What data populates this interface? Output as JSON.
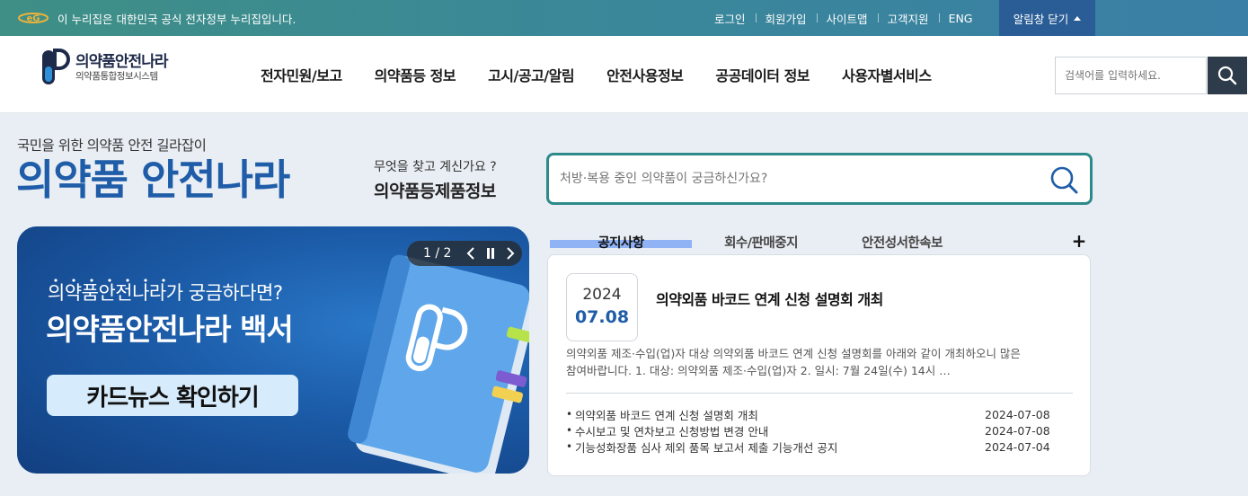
{
  "gov_banner": {
    "text": "이 누리집은 대한민국 공식 전자정부 누리집입니다.",
    "links": [
      "로그인",
      "회원가입",
      "사이트맵",
      "고객지원",
      "ENG"
    ],
    "close_label": "알림창 닫기"
  },
  "header": {
    "logo_title": "의약품안전나라",
    "logo_subtitle": "의약품통합정보시스템",
    "nav": [
      "전자민원/보고",
      "의약품등 정보",
      "고시/공고/알림",
      "안전사용정보",
      "공공데이터 정보",
      "사용자별서비스"
    ],
    "search_placeholder": "검색어를 입력하세요."
  },
  "hero": {
    "subtitle": "국민을 위한 의약품 안전 길라잡이",
    "title": "의약품 안전나라",
    "question": "무엇을 찾고 계신가요 ?",
    "category": "의약품등제품정보",
    "search_placeholder": "처방·복용 중인 의약품이 궁금하신가요?"
  },
  "banner": {
    "subtitle": "의약품안전나라가 궁금하다면?",
    "title": "의약품안전나라 백서",
    "cta": "카드뉴스 확인하기",
    "pager": "1 / 2"
  },
  "notice": {
    "tabs": [
      "공지사항",
      "회수/판매중지",
      "안전성서한속보"
    ],
    "more": "+",
    "featured": {
      "year": "2024",
      "date": "07.08",
      "title": "의약외품 바코드 연계 신청 설명회 개최",
      "body": "의약외품 제조·수입(업)자 대상 의약외품 바코드 연계 신청 설명회를 아래와 같이 개최하오니 많은 참여바랍니다.    1. 대상: 의약외품 제조·수입(업)자  2. 일시: 7월 24일(수) 14시 …"
    },
    "items": [
      {
        "title": "의약외품 바코드 연계 신청 설명회 개최",
        "date": "2024-07-08"
      },
      {
        "title": "수시보고 및 연차보고 신청방법 변경 안내",
        "date": "2024-07-08"
      },
      {
        "title": "기능성화장품 심사 제외 품목 보고서 제출 기능개선 공지",
        "date": "2024-07-04"
      }
    ]
  },
  "colors": {
    "brand_blue": "#1f5da8",
    "search_border": "#2e8a8a",
    "tab_highlight": "#8fb3f5",
    "dark_button": "#2e3b4a"
  }
}
